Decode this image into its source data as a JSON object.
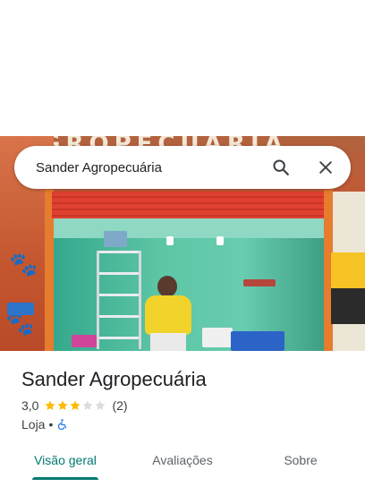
{
  "search": {
    "query": "Sander Agropecuária"
  },
  "hero": {
    "sign_text": "AGROPECUÁRIA"
  },
  "place": {
    "name": "Sander Agropecuária",
    "rating": "3,0",
    "rating_value": 3,
    "rating_max": 5,
    "review_count": "(2)",
    "category": "Loja",
    "separator": "•",
    "accessibility_icon": "wheelchair-icon"
  },
  "tabs": [
    {
      "label": "Visão geral",
      "active": true
    },
    {
      "label": "Avaliações",
      "active": false
    },
    {
      "label": "Sobre",
      "active": false
    }
  ],
  "colors": {
    "accent": "#01796f",
    "star_filled": "#fbbc04",
    "star_empty": "#dadce0",
    "accessibility_blue": "#1a73e8"
  }
}
